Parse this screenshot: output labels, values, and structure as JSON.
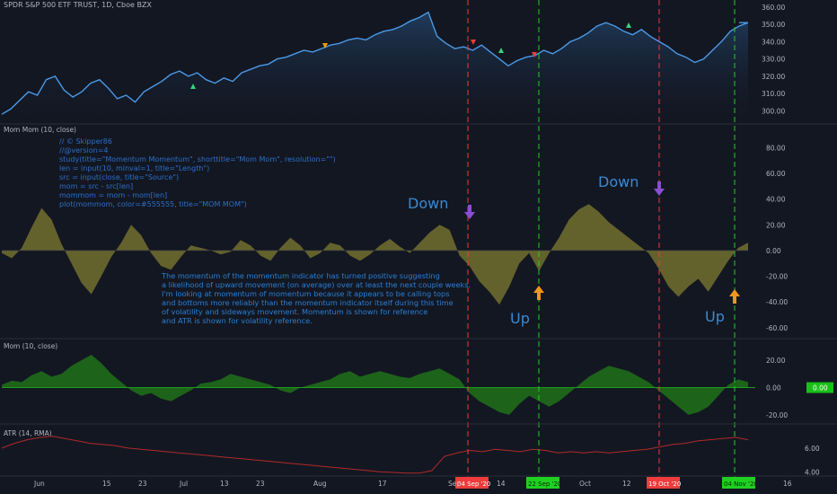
{
  "header": {
    "symbol": "SPDR S&P 500 ETF TRUST, 1D, Cboe BZX",
    "mom_mom_label": "Mom Mom (10, close)",
    "mom_label": "Mom (10, close)",
    "atr_label": "ATR (14, RMA)"
  },
  "script_lines": [
    "// © Skipper86",
    "//@version=4",
    "study(title=\"Momentum Momentum\", shorttitle=\"Mom Mom\", resolution=\"\")",
    "len = input(10, minval=1, title=\"Length\")",
    "src = input(close, title=\"Source\")",
    "mom = src - src[len]",
    "mommom = mom - mom[len]",
    "plot(mommom, color=#555555, title=\"MOM MOM\")"
  ],
  "note_lines": [
    "The momentum of the momentum indicator has turned positive suggesting",
    "a likelihood of upward movement (on average) over at least the next couple weeks.",
    "I'm looking at momentum of momentum because it appears to be calling tops",
    "and bottoms more reliably than the momentum indicator itself during this time",
    "of volatility and sideways movement.  Momentum is shown for reference",
    "and ATR is shown for volatility reference."
  ],
  "annotations": {
    "down": "Down",
    "up": "Up"
  },
  "colors": {
    "background": "#131722",
    "price_line": "#4a9ae8",
    "mommom_fill": "#6e6a2e",
    "mom_fill": "#1f6b1a",
    "atr_line": "#b02a2a",
    "red_marker": "#ef3b3b",
    "green_marker": "#20d020",
    "arrow_purple": "#8a4fd0",
    "arrow_orange": "#f0961c",
    "annotation_text": "#3a8ad4",
    "script_text": "#2a6fc9"
  },
  "chart_data": [
    {
      "type": "area",
      "title": "SPDR S&P 500 ETF TRUST, 1D, Cboe BZX",
      "ylim": [
        295,
        362
      ],
      "yticks": [
        "360.00",
        "350.00",
        "340.00",
        "330.00",
        "320.00",
        "310.00",
        "300.00"
      ],
      "xticks": [
        "Jun",
        "15",
        "23",
        "Jul",
        "13",
        "23",
        "Aug",
        "17",
        "Sep",
        "14",
        "22 Sep '20",
        "Oct",
        "12",
        "19 Oct '20",
        "4 Nov '20",
        "16"
      ],
      "price_values": [
        298,
        301,
        306,
        311,
        309,
        318,
        320,
        312,
        308,
        311,
        316,
        318,
        313,
        307,
        309,
        305,
        311,
        314,
        317,
        321,
        323,
        320,
        322,
        318,
        316,
        319,
        317,
        322,
        324,
        326,
        327,
        330,
        331,
        333,
        335,
        334,
        336,
        338,
        339,
        341,
        342,
        341,
        344,
        346,
        347,
        349,
        352,
        354,
        357,
        343,
        339,
        336,
        337,
        335,
        338,
        334,
        330,
        326,
        329,
        331,
        332,
        335,
        333,
        336,
        340,
        342,
        345,
        349,
        351,
        349,
        346,
        344,
        347,
        343,
        340,
        337,
        333,
        331,
        328,
        330,
        335,
        340,
        346,
        349,
        351
      ]
    },
    {
      "type": "area",
      "title": "Mom Mom (10, close)",
      "ylim": [
        -65,
        90
      ],
      "yticks": [
        "80.00",
        "60.00",
        "40.00",
        "20.00",
        "0.00",
        "-20.00",
        "-40.00",
        "-60.00"
      ],
      "values": [
        -2,
        -6,
        2,
        18,
        33,
        24,
        5,
        -10,
        -25,
        -34,
        -20,
        -5,
        6,
        20,
        12,
        -2,
        -12,
        -15,
        -5,
        4,
        2,
        0,
        -3,
        -1,
        8,
        4,
        -4,
        -8,
        2,
        10,
        4,
        -6,
        -2,
        6,
        4,
        -4,
        -8,
        -3,
        4,
        9,
        3,
        -2,
        6,
        14,
        20,
        16,
        -4,
        -12,
        -24,
        -32,
        -42,
        -28,
        -10,
        -2,
        -16,
        -2,
        10,
        24,
        32,
        36,
        30,
        22,
        16,
        10,
        4,
        -2,
        -14,
        -28,
        -36,
        -28,
        -22,
        -32,
        -20,
        -8,
        2,
        6
      ]
    },
    {
      "type": "area",
      "title": "Mom (10, close)",
      "ylim": [
        -24,
        26
      ],
      "yticks": [
        "20.00",
        "0.00",
        "-20.00"
      ],
      "last_value": "0.00",
      "values": [
        2,
        5,
        4,
        9,
        12,
        8,
        10,
        16,
        20,
        24,
        18,
        10,
        4,
        -2,
        -6,
        -4,
        -8,
        -10,
        -6,
        -2,
        3,
        4,
        6,
        10,
        8,
        6,
        4,
        2,
        -2,
        -4,
        0,
        2,
        4,
        6,
        10,
        12,
        8,
        10,
        12,
        10,
        8,
        7,
        10,
        12,
        14,
        10,
        6,
        -4,
        -10,
        -14,
        -18,
        -20,
        -12,
        -6,
        -10,
        -14,
        -10,
        -4,
        2,
        8,
        12,
        16,
        14,
        12,
        8,
        4,
        -2,
        -8,
        -14,
        -20,
        -18,
        -14,
        -6,
        2,
        6,
        4
      ]
    },
    {
      "type": "line",
      "title": "ATR (14, RMA)",
      "ylim": [
        3.8,
        7.2
      ],
      "yticks": [
        "6.00",
        "4.00"
      ],
      "values": [
        6.0,
        6.4,
        6.7,
        6.9,
        7.0,
        6.8,
        6.6,
        6.4,
        6.3,
        6.2,
        6.0,
        5.9,
        5.8,
        5.7,
        5.6,
        5.5,
        5.4,
        5.3,
        5.2,
        5.1,
        5.0,
        4.9,
        4.8,
        4.7,
        4.6,
        4.5,
        4.4,
        4.3,
        4.2,
        4.1,
        4.0,
        3.95,
        3.9,
        3.9,
        4.1,
        5.3,
        5.6,
        5.8,
        5.7,
        5.9,
        5.8,
        5.7,
        5.9,
        5.8,
        5.6,
        5.7,
        5.6,
        5.7,
        5.6,
        5.7,
        5.8,
        5.9,
        6.1,
        6.3,
        6.4,
        6.6,
        6.7,
        6.8,
        6.9,
        6.7
      ]
    }
  ],
  "date_markers": [
    {
      "label": "04 Sep '20",
      "kind": "red"
    },
    {
      "label": "22 Sep '20",
      "kind": "green"
    },
    {
      "label": "19 Oct '20",
      "kind": "red"
    },
    {
      "label": "04 Nov '20",
      "kind": "green"
    }
  ]
}
